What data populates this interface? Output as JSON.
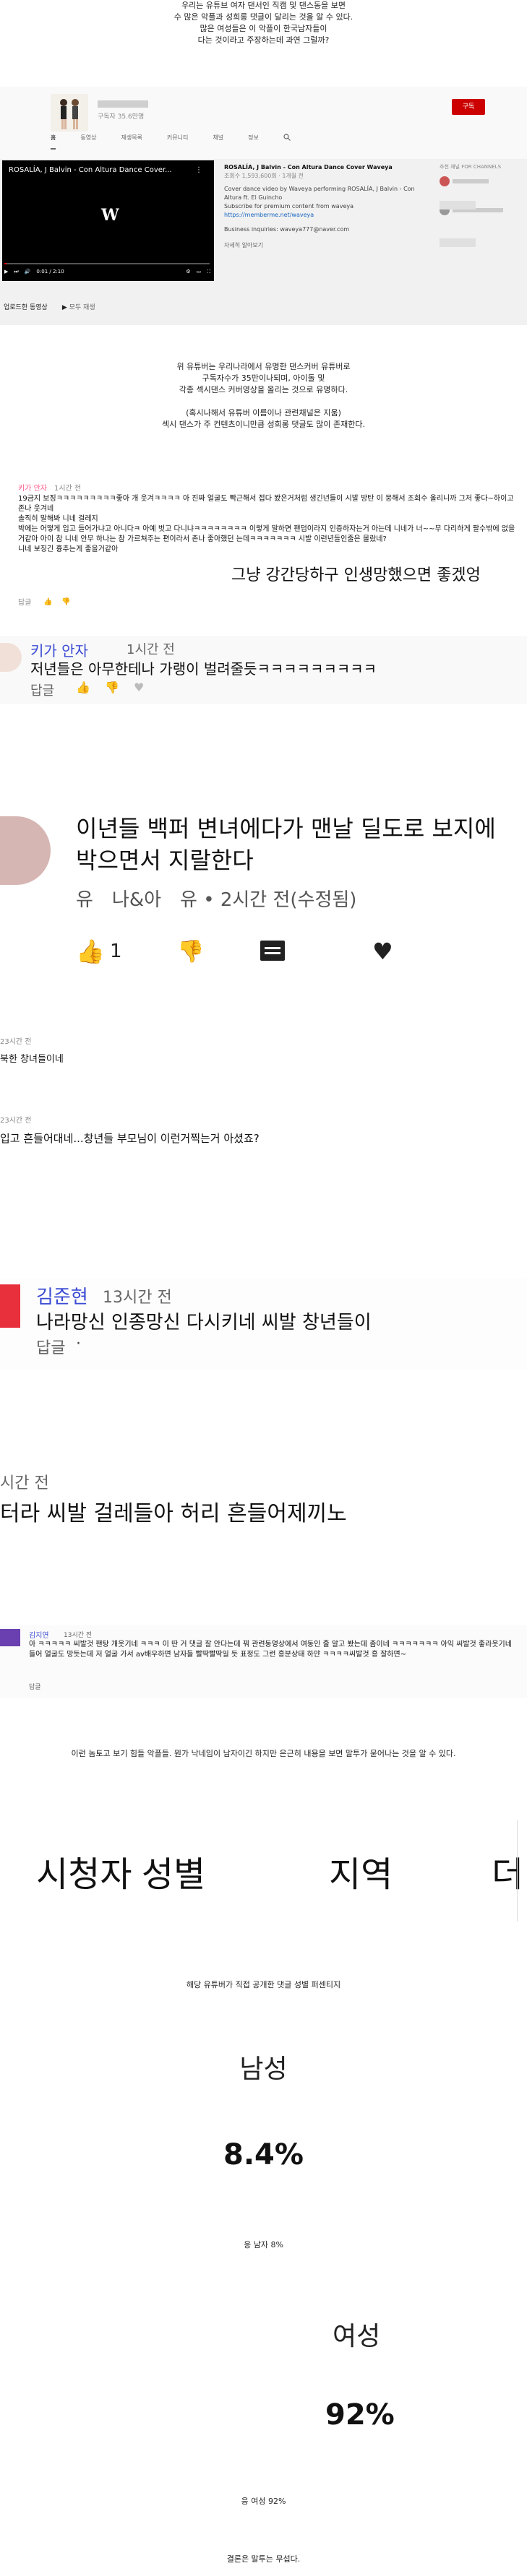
{
  "intro": {
    "lines": [
      "우리는 유튜브 여자 댄서인 직캠 및 댄스동을 보면",
      "수 많은 악플과 성희롱 댓글이 달리는 것을 알 수 있다.",
      "많은 여성들은 이 악플이 한국남자들이",
      "다는 것이라고 주장하는데 과연 그럴까?"
    ]
  },
  "channel": {
    "name": "",
    "subs": "구독자 35.6만명",
    "subscribe_label": "구독",
    "tabs": [
      "홈",
      "동영상",
      "재생목록",
      "커뮤니티",
      "채널",
      "정보"
    ],
    "search_icon": "search-icon"
  },
  "video": {
    "title": "ROSALÍA, J Balvin - Con Altura Dance Cover...",
    "logo": "W",
    "time": "0:01 / 2:10",
    "desc_title": "ROSALÍA, J Balvin - Con Altura Dance Cover Waveya",
    "meta": "조회수 1,593,600회 · 1개월 전",
    "desc1": "Cover dance video by Waveya performing ROSALÍA, J Balvin - Con Altura ft. El Guincho",
    "desc2": "Subscribe for premium content from waveya",
    "link": "https://memberme.net/waveya",
    "business": "Business inquiries: waveya777@naver.com",
    "more": "자세히 알아보기",
    "side_title": "추천 채널 FOR CHANNELS",
    "uploads_label": "업로드한 동영상",
    "play_all": "모두 재생"
  },
  "mid_text": {
    "lines": [
      "위 유튜버는 우리나라에서 유명한 댄스커버 유튜버로",
      "구독자수가 35만이나되며, 아이돌 및",
      "각종 섹시댄스 커버영상을 올리는 것으로 유명하다.",
      "",
      "(혹시나해서 유튜버 이름이나 관련채널은 지움)",
      "섹시 댄스가 주 컨텐츠이니만큼 성희롱 댓글도 많이 존재한다."
    ]
  },
  "comment1": {
    "name": "키가 안자",
    "time": "1시간 전",
    "text": "19금지 보징ㅋㅋㅋㅋㅋㅋㅋㅋㅋ좋아 개 웃겨ㅋㅋㅋㅋ 아 진짜 얼굴도 빡근해서 접다 봤은거처럼 생긴년들이 시발 방탄 이 뭉해서 조회수 올리니까 그저 좋다~하이고 존나 웃겨네",
    "text2": "솔직히 말해봐 니네 걸레지",
    "text3": "박에는 어떻게 입고 들어가냐고 아니다ㅋ 아예 벗고 다니냐ㅋㅋㅋㅋㅋㅋㅋㅋ 이렇게 말하면 팬덤이라지 인증하자는거 아는데 니네가 너~~무 다리하게 팔수밖에 없을거같아 아이 참 니네 안무 하나는 참 가르쳐주는 편이라서 존나 좋아했던 는데ㅋㅋㅋㅋㅋㅋㅋ 시발 이런년들인줄은 몰랐네?",
    "text4": "니네 보징긴 흉추는게 좋을거같아",
    "overlay": "그냥 강간당하구 인생망했으면 좋겠엉",
    "reply": "답글"
  },
  "comment2": {
    "name": "키가 안자",
    "time": "1시간 전",
    "text": "저년들은 아무한테나 가랭이 벌려줄듯ㅋㅋㅋㅋㅋㅋㅋㅋㅋ",
    "reply": "답글"
  },
  "comment3": {
    "text": "이년들 백퍼 변녀에다가 맨날 딜도로 보지에 박으면서 지랄한다",
    "meta": "유　나&아　유 • 2시간 전(수정됨)",
    "likes": "1"
  },
  "comment4": {
    "time": "23시간 전",
    "prefix": "북한 창녀들이네"
  },
  "comment5": {
    "time": "23시간 전",
    "text": "입고 흔들어대네...창년들 부모님이 이런거찍는거 아셨죠?"
  },
  "comment6": {
    "name": "김준현",
    "time": "13시간 전",
    "text": "나라망신 인종망신 다시키네 씨발 창년들이",
    "reply": "답글"
  },
  "comment7": {
    "time": "시간 전",
    "text": "터라 씨발 걸레들아 허리 흔들어제끼노"
  },
  "comment8": {
    "name": "김지연",
    "time": "13시간 전",
    "text": "아 ㅋㅋㅋㅋㅋ 씨발것 팬탕 개웃기네 ㅋㅋㅋ 이 딴 거 댓글 잘 안다는데 꿔 관련동영상에서 여동인 줄 알고 봤는데 좀이네 ㅋㅋㅋㅋㅋㅋㅋ 아익 씨발것 좋라웃기네 들어 얼굴도 망듯는데 저 얼굴 가서 av배우하면 남자들 빨딱빨딱일 듯 표정도 그런 흥분상태 하얀 ㅋㅋㅋㅋ씨발것 흥 잘하면~",
    "reply": "답글"
  },
  "bottom_note": "이런 놈토고 보기 힘들 악플들. 뭔가 낙네임이 남자이긴 하지만 은근히 내용을 보면 말투가 묻어나는 것을 알 수 있다.",
  "stats": {
    "header_left": "시청자 성별",
    "header_mid": "지역",
    "header_right": "더",
    "caption": "해당 유튜버가 직접 공개한 댓글 성별 퍼센티지",
    "male_label": "남성",
    "male_value": "8.4%",
    "male_caption": "응 남자 8%",
    "female_label": "여성",
    "female_value": "92%",
    "female_caption": "응 여성 92%",
    "conclusion": "결론은 말투는 무섭다."
  }
}
